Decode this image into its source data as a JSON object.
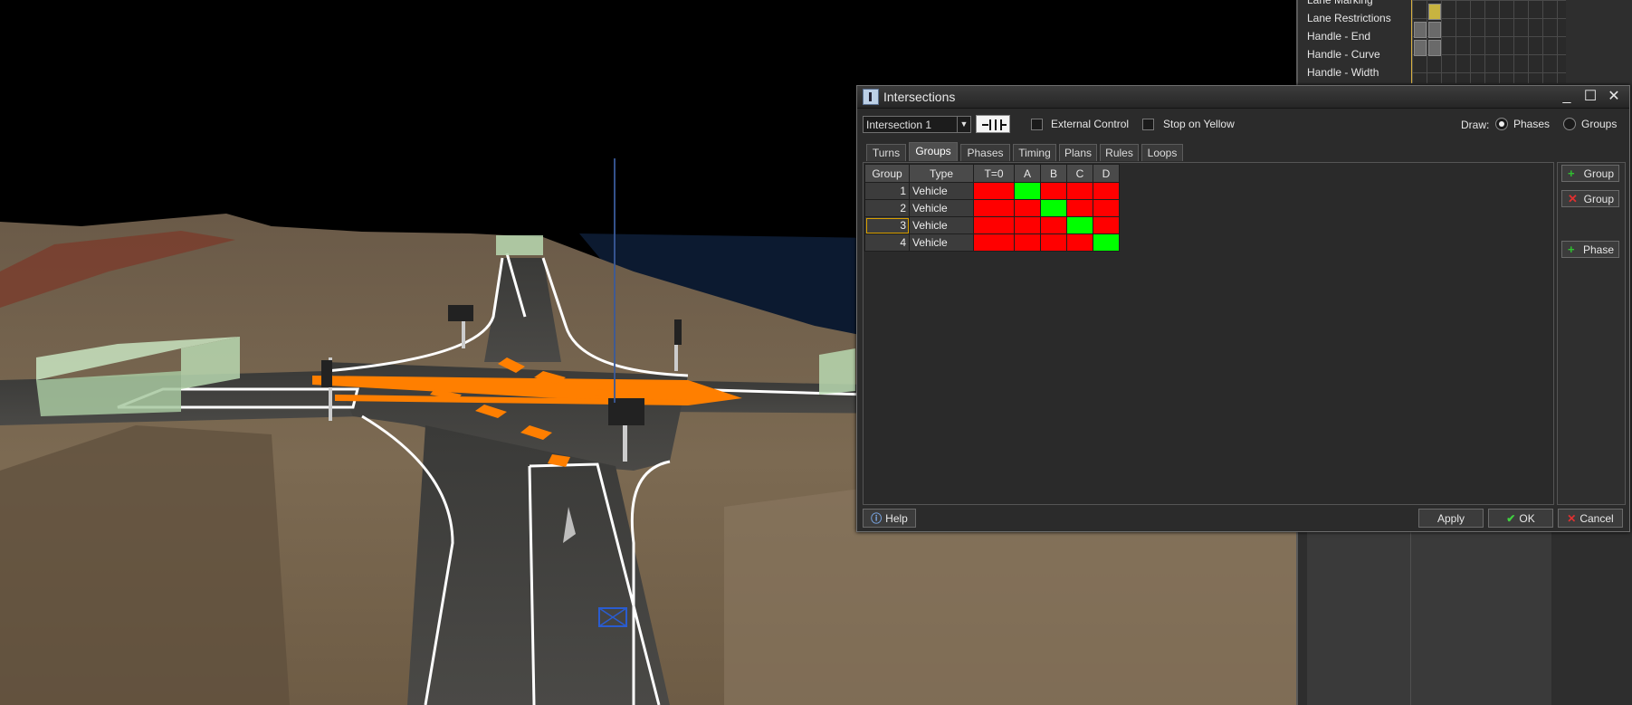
{
  "layers": {
    "items": [
      {
        "label": "Lane Marking"
      },
      {
        "label": "Lane Restrictions"
      },
      {
        "label": "Handle - End"
      },
      {
        "label": "Handle - Curve"
      },
      {
        "label": "Handle - Width"
      }
    ]
  },
  "dialog": {
    "title": "Intersections",
    "intersection_select": "Intersection 1",
    "external_control_label": "External Control",
    "stop_on_yellow_label": "Stop on Yellow",
    "draw_label": "Draw:",
    "draw_options": [
      {
        "label": "Phases",
        "selected": true
      },
      {
        "label": "Groups",
        "selected": false
      }
    ],
    "tabs": [
      {
        "label": "Turns",
        "active": false
      },
      {
        "label": "Groups",
        "active": true
      },
      {
        "label": "Phases",
        "active": false
      },
      {
        "label": "Timing",
        "active": false
      },
      {
        "label": "Plans",
        "active": false
      },
      {
        "label": "Rules",
        "active": false
      },
      {
        "label": "Loops",
        "active": false
      }
    ],
    "table": {
      "headers": [
        "Group",
        "Type",
        "T=0",
        "A",
        "B",
        "C",
        "D"
      ],
      "rows": [
        {
          "group": "1",
          "type": "Vehicle",
          "states": [
            "red",
            "green",
            "red",
            "red",
            "red"
          ]
        },
        {
          "group": "2",
          "type": "Vehicle",
          "states": [
            "red",
            "red",
            "green",
            "red",
            "red"
          ]
        },
        {
          "group": "3",
          "type": "Vehicle",
          "states": [
            "red",
            "red",
            "red",
            "green",
            "red"
          ],
          "selected": true
        },
        {
          "group": "4",
          "type": "Vehicle",
          "states": [
            "red",
            "red",
            "red",
            "red",
            "green"
          ]
        }
      ]
    },
    "side_buttons": [
      {
        "icon": "plus-icon",
        "label": "Group"
      },
      {
        "icon": "x-icon",
        "label": "Group"
      },
      {
        "icon": "plus-icon",
        "label": "Phase"
      }
    ],
    "footer": {
      "help_label": "Help",
      "apply_label": "Apply",
      "ok_label": "OK",
      "cancel_label": "Cancel"
    }
  },
  "colors": {
    "red_state": "#ff0000",
    "green_state": "#00ff00",
    "road_marking": "#ff7f00"
  }
}
